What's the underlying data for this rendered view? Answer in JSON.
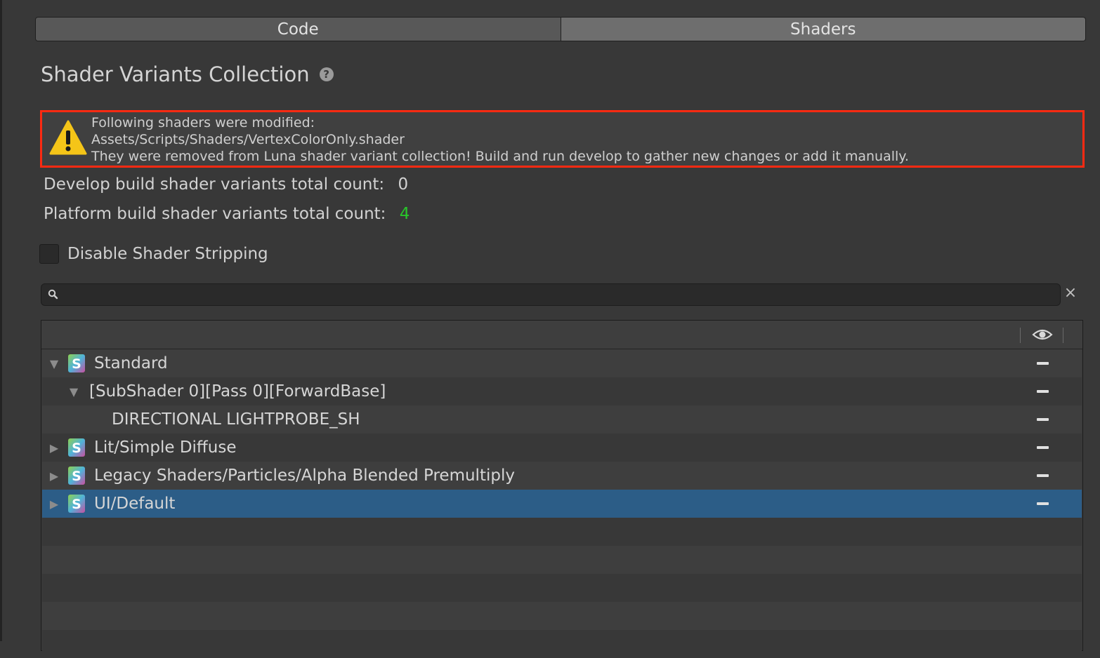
{
  "tabs": [
    {
      "label": "Code",
      "active": false
    },
    {
      "label": "Shaders",
      "active": true
    }
  ],
  "header": {
    "title": "Shader Variants Collection",
    "help_icon": "help-icon"
  },
  "warning": {
    "icon": "warning-icon",
    "border_color": "#ff2a12",
    "line1": "Following shaders were modified:",
    "line2": "Assets/Scripts/Shaders/VertexColorOnly.shader",
    "line3": "They were removed from Luna shader variant collection! Build and run develop to gather new changes or add it manually."
  },
  "stats": {
    "develop_label": "Develop build shader variants total count:",
    "develop_value": "0",
    "platform_label": "Platform build shader variants total count:",
    "platform_value": "4",
    "platform_value_color": "#28c62a"
  },
  "checkbox": {
    "label": "Disable Shader Stripping",
    "checked": false
  },
  "search": {
    "value": "",
    "placeholder": ""
  },
  "tree": {
    "header_icon": "eye-icon",
    "rows": [
      {
        "label": "Standard",
        "expanded": true,
        "has_icon": true,
        "depth": 0
      },
      {
        "label": "[SubShader 0][Pass 0][ForwardBase]",
        "expanded": true,
        "has_icon": false,
        "depth": 1
      },
      {
        "label": "DIRECTIONAL LIGHTPROBE_SH",
        "has_icon": false,
        "depth": 2
      },
      {
        "label": "Lit/Simple Diffuse",
        "expanded": false,
        "has_icon": true,
        "depth": 0
      },
      {
        "label": "Legacy Shaders/Particles/Alpha Blended Premultiply",
        "expanded": false,
        "has_icon": true,
        "depth": 0
      },
      {
        "label": "UI/Default",
        "expanded": false,
        "has_icon": true,
        "depth": 0,
        "selected": true
      }
    ],
    "selected_color": "#2c5d87"
  }
}
